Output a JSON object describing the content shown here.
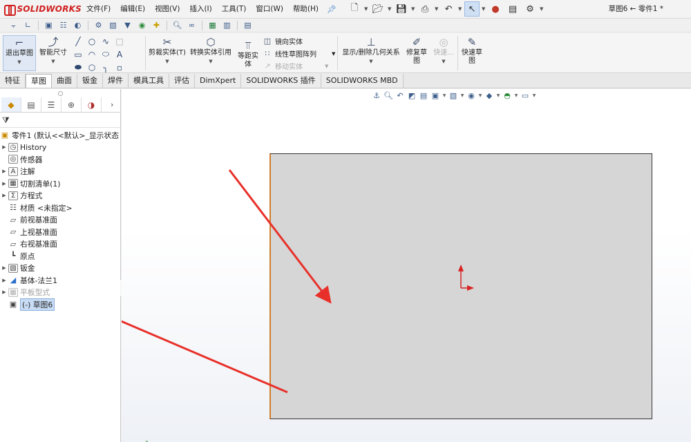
{
  "app": {
    "logo_text": "SOLIDWORKS",
    "doc_title": "草图6 ← 零件1 *"
  },
  "menu": [
    "文件(F)",
    "编辑(E)",
    "视图(V)",
    "插入(I)",
    "工具(T)",
    "窗口(W)",
    "帮助(H)"
  ],
  "ribbon": {
    "exit_sketch": "退出草图",
    "smart_dimension": "智能尺寸",
    "trim": "剪裁实体(T)",
    "convert": "转换实体引用",
    "offset_1": "等距实",
    "offset_2": "体",
    "mirror": "镜向实体",
    "linear_pattern": "线性草图阵列",
    "move": "移动实体",
    "display_relations": "显示/删除几何关系",
    "repair_1": "修复草",
    "repair_2": "图",
    "quick_1": "快速...",
    "quick_snap_1": "快速草",
    "quick_snap_2": "图"
  },
  "tabs": [
    "特征",
    "草图",
    "曲面",
    "钣金",
    "焊件",
    "模具工具",
    "评估",
    "DimXpert",
    "SOLIDWORKS 插件",
    "SOLIDWORKS MBD"
  ],
  "active_tab": "草图",
  "tree": {
    "root": "零件1 (默认<<默认>_显示状态",
    "items": [
      {
        "label": "History",
        "expand": true
      },
      {
        "label": "传感器",
        "expand": false
      },
      {
        "label": "注解",
        "expand": true
      },
      {
        "label": "切割清单(1)",
        "expand": true
      },
      {
        "label": "方程式",
        "expand": true
      },
      {
        "label": "材质 <未指定>",
        "expand": false
      },
      {
        "label": "前视基准面",
        "expand": false
      },
      {
        "label": "上视基准面",
        "expand": false
      },
      {
        "label": "右视基准面",
        "expand": false
      },
      {
        "label": "原点",
        "expand": false
      },
      {
        "label": "钣金",
        "expand": true
      },
      {
        "label": "基体-法兰1",
        "expand": true
      },
      {
        "label": "平板型式",
        "expand": true
      },
      {
        "label": "(-) 草图6",
        "expand": false
      }
    ]
  },
  "colors": {
    "arrow": "#e8302a",
    "plate": "#d6d6d6",
    "plate_edge": "#333333",
    "plate_left_edge": "#d07d2a",
    "selection": "#c8dcf5"
  },
  "icons": [
    "pin-icon",
    "new-icon",
    "open-icon",
    "save-icon",
    "print-icon",
    "undo-icon",
    "select-icon",
    "traffic-light-icon",
    "options-icon"
  ]
}
